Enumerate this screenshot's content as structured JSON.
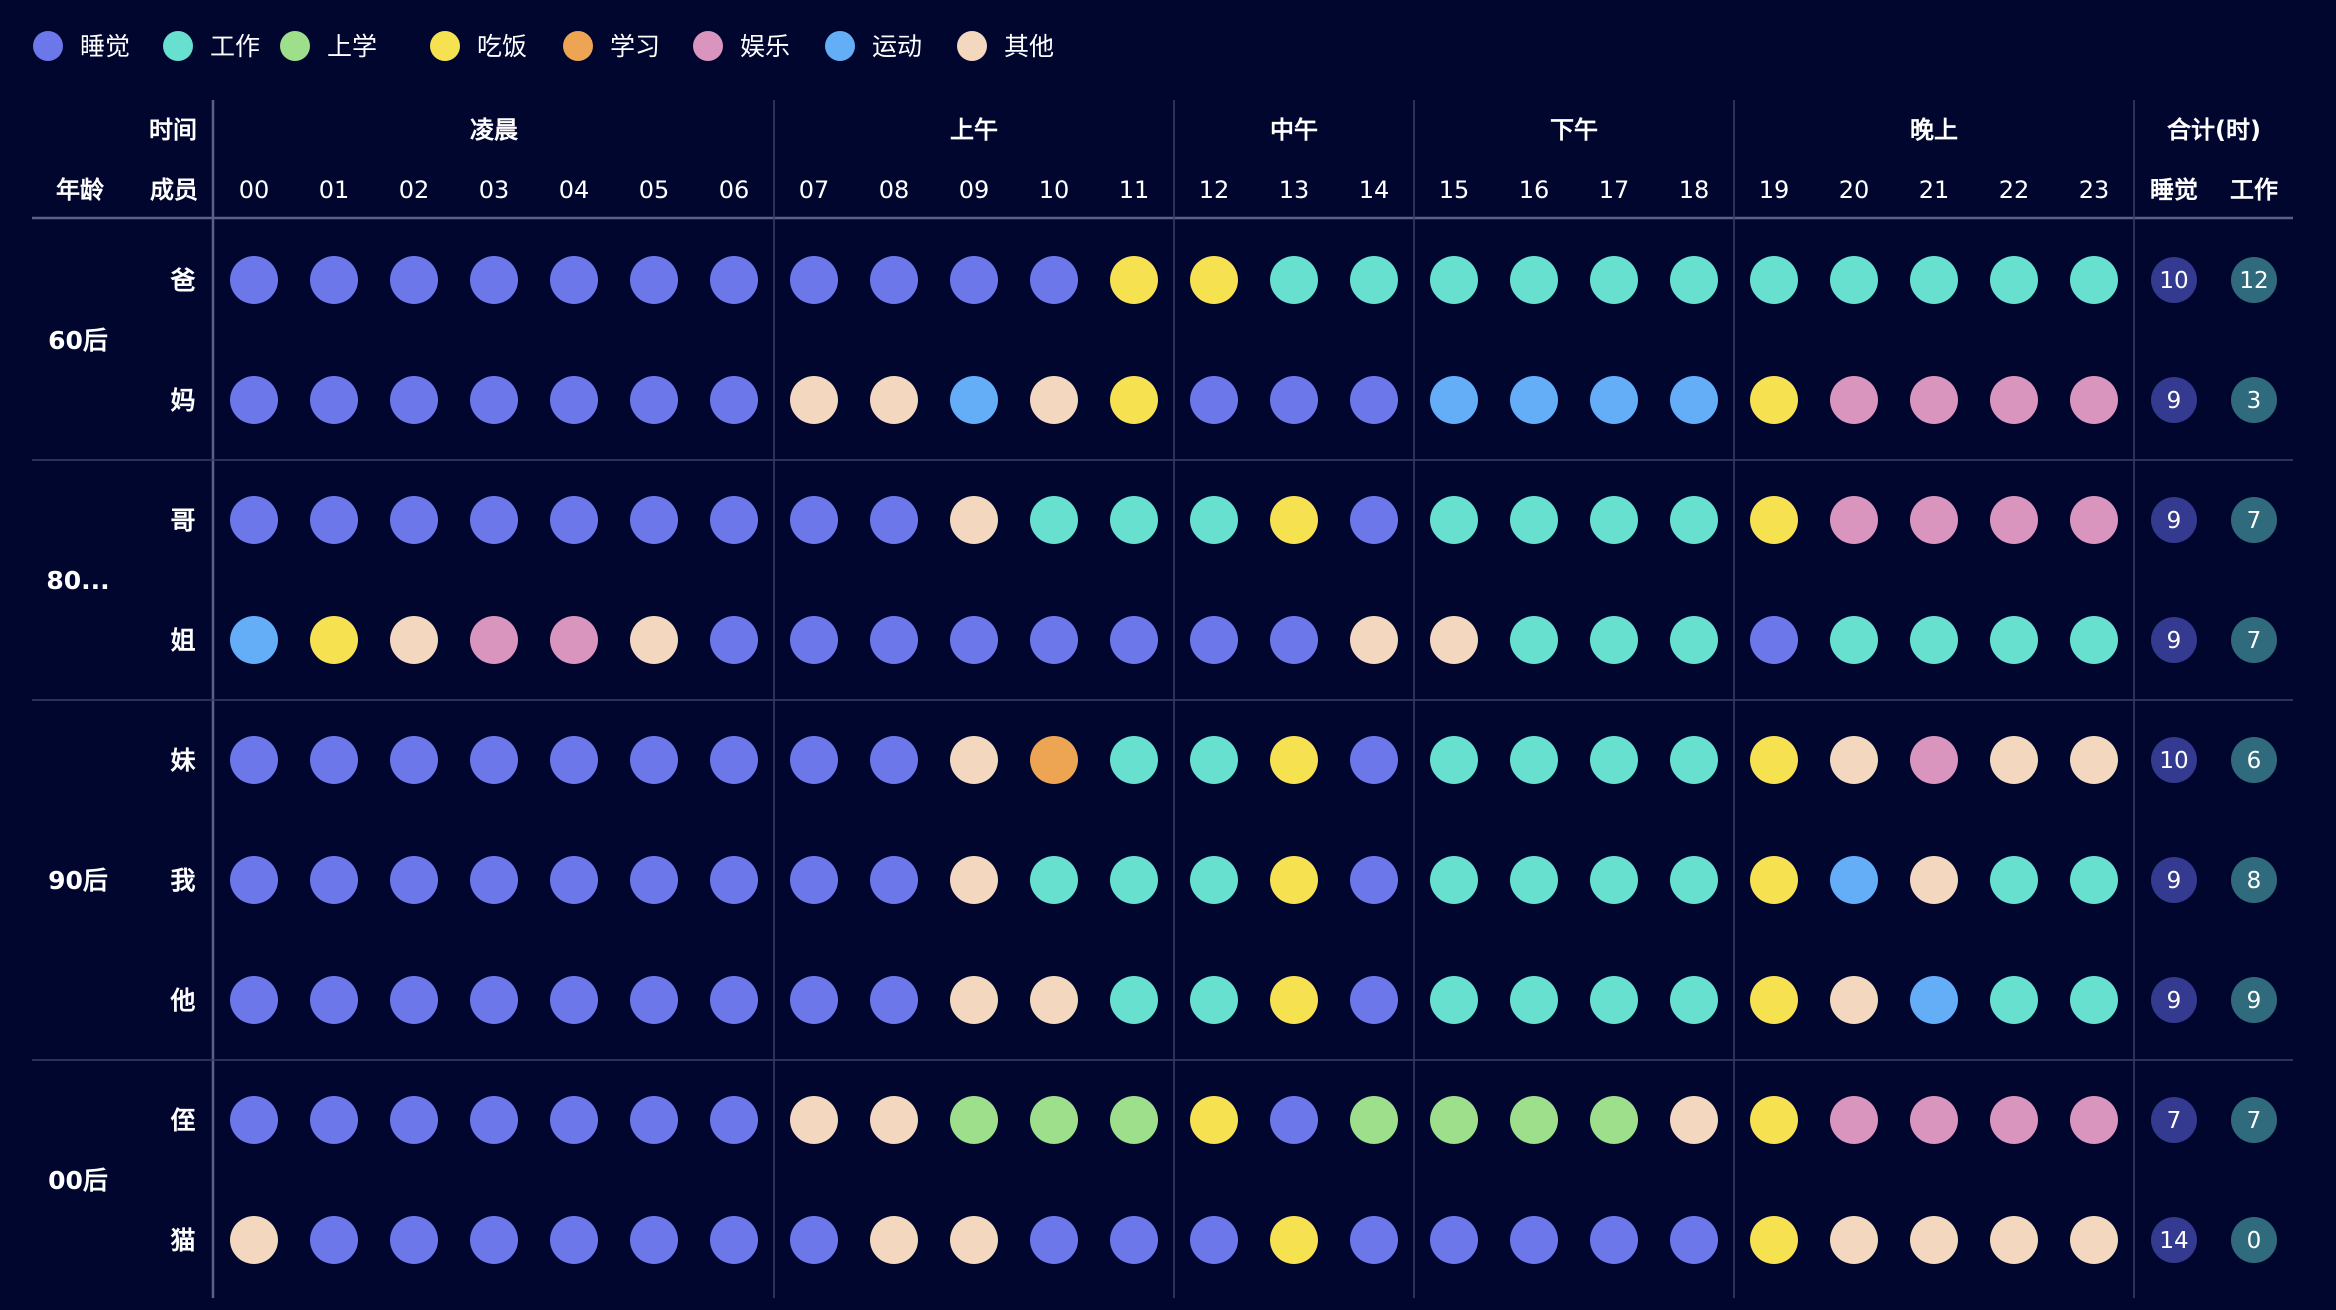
{
  "chart_data": {
    "type": "heatmap",
    "legend_placement": "top-left",
    "categories": [
      {
        "key": "sleep",
        "label": "睡觉",
        "color": "#6c78ea"
      },
      {
        "key": "work",
        "label": "工作",
        "color": "#67e0cf"
      },
      {
        "key": "school",
        "label": "上学",
        "color": "#9edf8c"
      },
      {
        "key": "eat",
        "label": "吃饭",
        "color": "#f6e251"
      },
      {
        "key": "study",
        "label": "学习",
        "color": "#eea553"
      },
      {
        "key": "fun",
        "label": "娱乐",
        "color": "#d995bd"
      },
      {
        "key": "sport",
        "label": "运动",
        "color": "#63aef7"
      },
      {
        "key": "other",
        "label": "其他",
        "color": "#f3d8bf"
      }
    ],
    "header": {
      "time_label": "时间",
      "age_label": "年龄",
      "member_label": "成员",
      "total_label": "合计(时)",
      "total_columns": [
        "睡觉",
        "工作"
      ]
    },
    "periods": [
      {
        "label": "凌晨",
        "hours": [
          "00",
          "01",
          "02",
          "03",
          "04",
          "05",
          "06"
        ]
      },
      {
        "label": "上午",
        "hours": [
          "07",
          "08",
          "09",
          "10",
          "11"
        ]
      },
      {
        "label": "中午",
        "hours": [
          "12",
          "13",
          "14"
        ]
      },
      {
        "label": "下午",
        "hours": [
          "15",
          "16",
          "17",
          "18"
        ]
      },
      {
        "label": "晚上",
        "hours": [
          "19",
          "20",
          "21",
          "22",
          "23"
        ]
      }
    ],
    "groups": [
      {
        "label": "60后",
        "members": [
          {
            "name": "爸",
            "activities": [
              "sleep",
              "sleep",
              "sleep",
              "sleep",
              "sleep",
              "sleep",
              "sleep",
              "sleep",
              "sleep",
              "sleep",
              "sleep",
              "eat",
              "eat",
              "work",
              "work",
              "work",
              "work",
              "work",
              "work",
              "work",
              "work",
              "work",
              "work",
              "work"
            ],
            "sleep_total": 10,
            "work_total": 12
          },
          {
            "name": "妈",
            "activities": [
              "sleep",
              "sleep",
              "sleep",
              "sleep",
              "sleep",
              "sleep",
              "sleep",
              "other",
              "other",
              "sport",
              "other",
              "eat",
              "sleep",
              "sleep",
              "sleep",
              "sport",
              "sport",
              "sport",
              "sport",
              "eat",
              "fun",
              "fun",
              "fun",
              "fun"
            ],
            "sleep_total": 9,
            "work_total": 3
          }
        ]
      },
      {
        "label": "80...",
        "members": [
          {
            "name": "哥",
            "activities": [
              "sleep",
              "sleep",
              "sleep",
              "sleep",
              "sleep",
              "sleep",
              "sleep",
              "sleep",
              "sleep",
              "other",
              "work",
              "work",
              "work",
              "eat",
              "sleep",
              "work",
              "work",
              "work",
              "work",
              "eat",
              "fun",
              "fun",
              "fun",
              "fun"
            ],
            "sleep_total": 9,
            "work_total": 7
          },
          {
            "name": "姐",
            "activities": [
              "sport",
              "eat",
              "other",
              "fun",
              "fun",
              "other",
              "sleep",
              "sleep",
              "sleep",
              "sleep",
              "sleep",
              "sleep",
              "sleep",
              "sleep",
              "other",
              "other",
              "work",
              "work",
              "work",
              "sleep",
              "work",
              "work",
              "work",
              "work"
            ],
            "sleep_total": 9,
            "work_total": 7
          }
        ]
      },
      {
        "label": "90后",
        "members": [
          {
            "name": "妹",
            "activities": [
              "sleep",
              "sleep",
              "sleep",
              "sleep",
              "sleep",
              "sleep",
              "sleep",
              "sleep",
              "sleep",
              "other",
              "study",
              "work",
              "work",
              "eat",
              "sleep",
              "work",
              "work",
              "work",
              "work",
              "eat",
              "other",
              "fun",
              "other",
              "other"
            ],
            "sleep_total": 10,
            "work_total": 6
          },
          {
            "name": "我",
            "activities": [
              "sleep",
              "sleep",
              "sleep",
              "sleep",
              "sleep",
              "sleep",
              "sleep",
              "sleep",
              "sleep",
              "other",
              "work",
              "work",
              "work",
              "eat",
              "sleep",
              "work",
              "work",
              "work",
              "work",
              "eat",
              "sport",
              "other",
              "work",
              "work"
            ],
            "sleep_total": 9,
            "work_total": 8
          },
          {
            "name": "他",
            "activities": [
              "sleep",
              "sleep",
              "sleep",
              "sleep",
              "sleep",
              "sleep",
              "sleep",
              "sleep",
              "sleep",
              "other",
              "other",
              "work",
              "work",
              "eat",
              "sleep",
              "work",
              "work",
              "work",
              "work",
              "eat",
              "other",
              "sport",
              "work",
              "work"
            ],
            "sleep_total": 9,
            "work_total": 9
          }
        ]
      },
      {
        "label": "00后",
        "members": [
          {
            "name": "侄",
            "activities": [
              "sleep",
              "sleep",
              "sleep",
              "sleep",
              "sleep",
              "sleep",
              "sleep",
              "other",
              "other",
              "school",
              "school",
              "school",
              "eat",
              "sleep",
              "school",
              "school",
              "school",
              "school",
              "other",
              "eat",
              "fun",
              "fun",
              "fun",
              "fun"
            ],
            "sleep_total": 7,
            "work_total": 7
          },
          {
            "name": "猫",
            "activities": [
              "other",
              "sleep",
              "sleep",
              "sleep",
              "sleep",
              "sleep",
              "sleep",
              "sleep",
              "other",
              "other",
              "sleep",
              "sleep",
              "sleep",
              "eat",
              "sleep",
              "sleep",
              "sleep",
              "sleep",
              "sleep",
              "eat",
              "other",
              "other",
              "other",
              "other"
            ],
            "sleep_total": 14,
            "work_total": 0
          }
        ]
      }
    ],
    "badge_colors": {
      "sleep_total": "#333a8f",
      "work_total": "#2f6b7c"
    },
    "grid_color": "#3a3f6a"
  }
}
